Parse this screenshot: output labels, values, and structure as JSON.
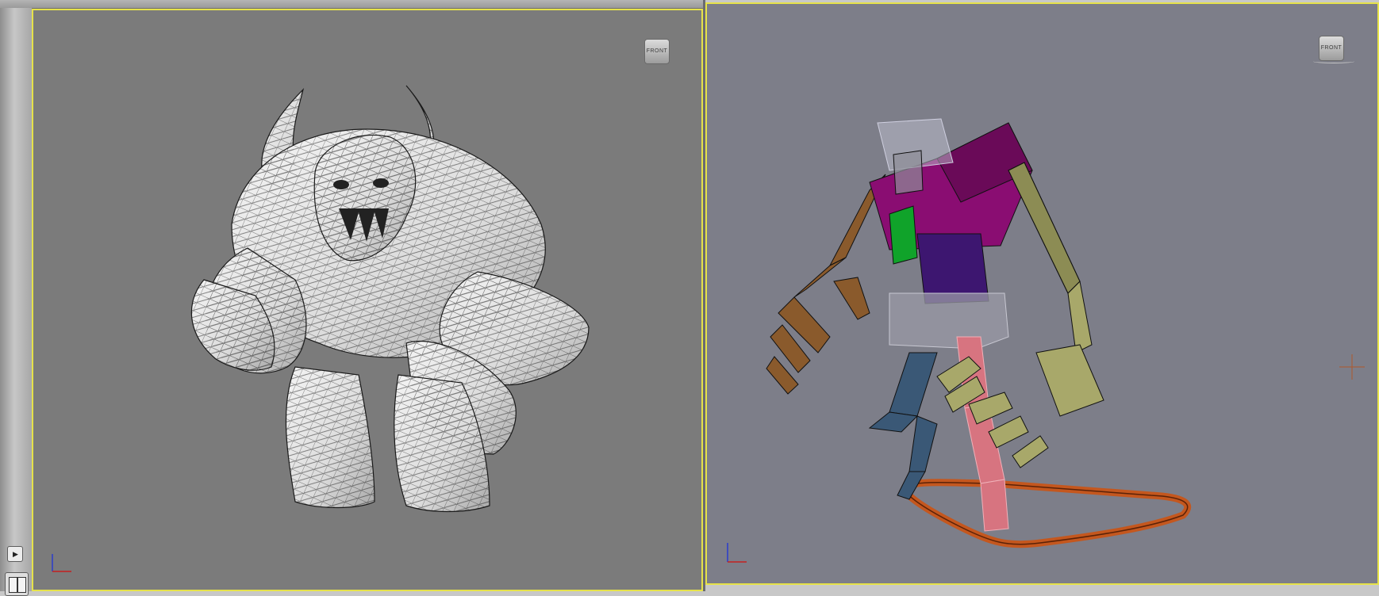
{
  "viewports": {
    "left": {
      "view_label": "FRONT"
    },
    "right": {
      "view_label": "FRONT"
    }
  },
  "colors": {
    "active_border": "#e6e24a",
    "left_bg": "#7b7b7b",
    "right_bg": "#7d7e89",
    "bone_head": "#8a0d72",
    "bone_neck": "#10a32a",
    "bone_spine": "#3d1670",
    "bone_pelvis": "#9a9aa6",
    "bone_arm_right": "#a8a86a",
    "bone_arm_left": "#8a5a2c",
    "bone_leg_left": "#3a5876",
    "bone_leg_right": "#d77480",
    "footstep_ring": "#c4571e"
  },
  "icons": [
    "play-icon",
    "layout-icon",
    "axis-tripod-icon",
    "viewcube-icon",
    "crosshair-icon"
  ]
}
